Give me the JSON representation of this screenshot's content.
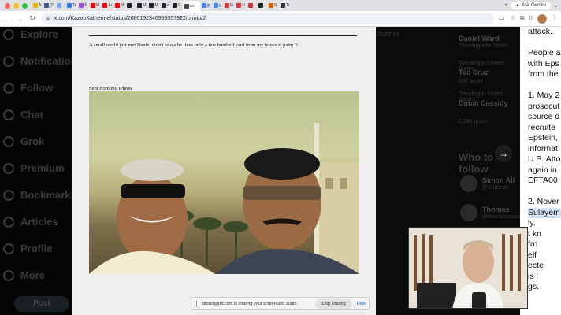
{
  "browser": {
    "tabs": [
      {
        "label": "A",
        "color": "#e9b400"
      },
      {
        "label": "(2",
        "color": "#3b5998"
      },
      {
        "label": "",
        "color": "#7aa7ff"
      },
      {
        "label": "Tr",
        "color": "#2b7de9"
      },
      {
        "label": "K",
        "color": "#9d4bd8"
      },
      {
        "label": "M",
        "color": "#ff0000"
      },
      {
        "label": "Ju",
        "color": "#ff0000"
      },
      {
        "label": "M",
        "color": "#ff0000"
      },
      {
        "label": "",
        "color": "#222222"
      },
      {
        "label": "M",
        "color": "#222222"
      },
      {
        "label": "M",
        "color": "#222222"
      },
      {
        "label": "w",
        "color": "#222222"
      },
      {
        "label": "E",
        "color": "#222222"
      },
      {
        "label": "do",
        "color": "#444444",
        "active": true
      },
      {
        "label": "gr",
        "color": "#4285f4"
      },
      {
        "label": "g",
        "color": "#4285f4"
      },
      {
        "label": "Ei",
        "color": "#d33"
      },
      {
        "label": "Li",
        "color": "#d33"
      },
      {
        "label": "",
        "color": "#d33"
      },
      {
        "label": "",
        "color": "#222222"
      },
      {
        "label": "R",
        "color": "#e06000"
      },
      {
        "label": "Ti",
        "color": "#333"
      }
    ],
    "ask_gemini": "Ask Gemini",
    "url": "x.com/KazooKatherine/status/2080152346999357922/photo/2"
  },
  "x_nav": [
    "Explore",
    "Notifications",
    "Follow",
    "Chat",
    "Grok",
    "Premium",
    "Bookmarks",
    "Articles",
    "Profile",
    "More"
  ],
  "post_button": "Post",
  "right_rail": {
    "top_link": "ourzoe",
    "name1": "Daniel Ward",
    "name1_sub": "Trending with Tekles",
    "trending_label": "Trending in United States",
    "trend1": "Ted Cruz",
    "trend1_posts": "83K posts",
    "trend2_label": "Trending in United States",
    "trend2": "Dutch Cassidy",
    "trend2_posts": "2,346 posts",
    "who_to_follow": "Who to follow",
    "follow1": "Simon Ali",
    "follow1_handle": "@SimonAl",
    "follow2": "Thomas",
    "follow2_handle": "@thomasmassie"
  },
  "document": {
    "line1": "A small world just met Daniel didn't know he lives only a few hundred yard from my house at palm !!",
    "signature": "Sent from my iPhone"
  },
  "article": {
    "lines": [
      "attack.",
      "",
      "People a",
      "with Eps",
      "from the",
      "",
      "1. May 2",
      "prosecut",
      "source d",
      "recruite",
      "Epstein,",
      "informat",
      "U.S. Atto",
      "again in",
      "EFTA00",
      "",
      "2. Nover",
      "Sulayem",
      "ly.",
      "t kn",
      "fro",
      "elf",
      "ecte",
      "is l",
      "gs."
    ]
  },
  "screenshare": {
    "message": "streamyard.com is sharing your screen and audio.",
    "stop": "Stop sharing",
    "hide": "Hide"
  }
}
